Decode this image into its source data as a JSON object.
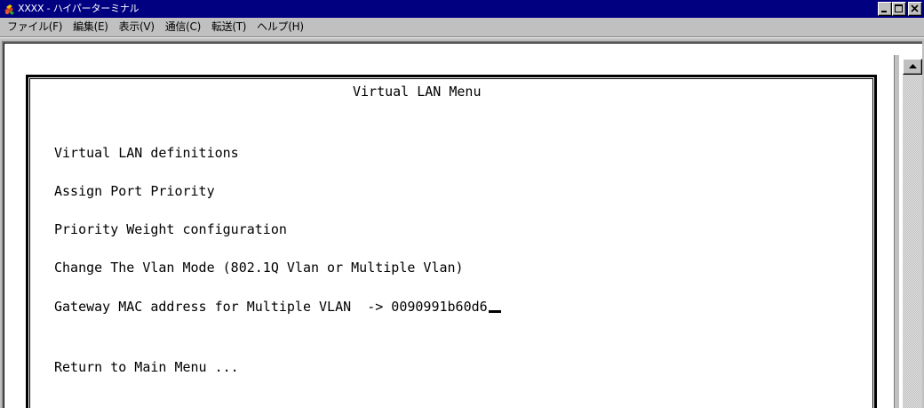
{
  "window": {
    "title": "XXXX - ハイパーターミナル"
  },
  "menubar": {
    "items": [
      {
        "label": "ファイル(F)"
      },
      {
        "label": "編集(E)"
      },
      {
        "label": "表示(V)"
      },
      {
        "label": "通信(C)"
      },
      {
        "label": "転送(T)"
      },
      {
        "label": "ヘルプ(H)"
      }
    ]
  },
  "terminal": {
    "heading": "Virtual LAN Menu",
    "menu": [
      {
        "label": "Virtual LAN definitions"
      },
      {
        "label": "Assign Port Priority"
      },
      {
        "label": "Priority Weight configuration"
      },
      {
        "label": "Change The Vlan Mode (802.1Q Vlan or Multiple Vlan)"
      },
      {
        "label": "Gateway MAC address for Multiple VLAN  -> 0090991b60d6"
      }
    ],
    "return_label": "Return to Main Menu ..."
  },
  "colors": {
    "titlebar": "#000080",
    "face": "#c0c0c0",
    "terminal_bg": "#ffffff",
    "terminal_fg": "#000000"
  },
  "icons": {
    "app": "hyperterminal-icon",
    "minimize": "minimize-icon",
    "maximize": "maximize-icon",
    "close": "close-icon",
    "scroll_up": "scroll-up-arrow-icon"
  }
}
